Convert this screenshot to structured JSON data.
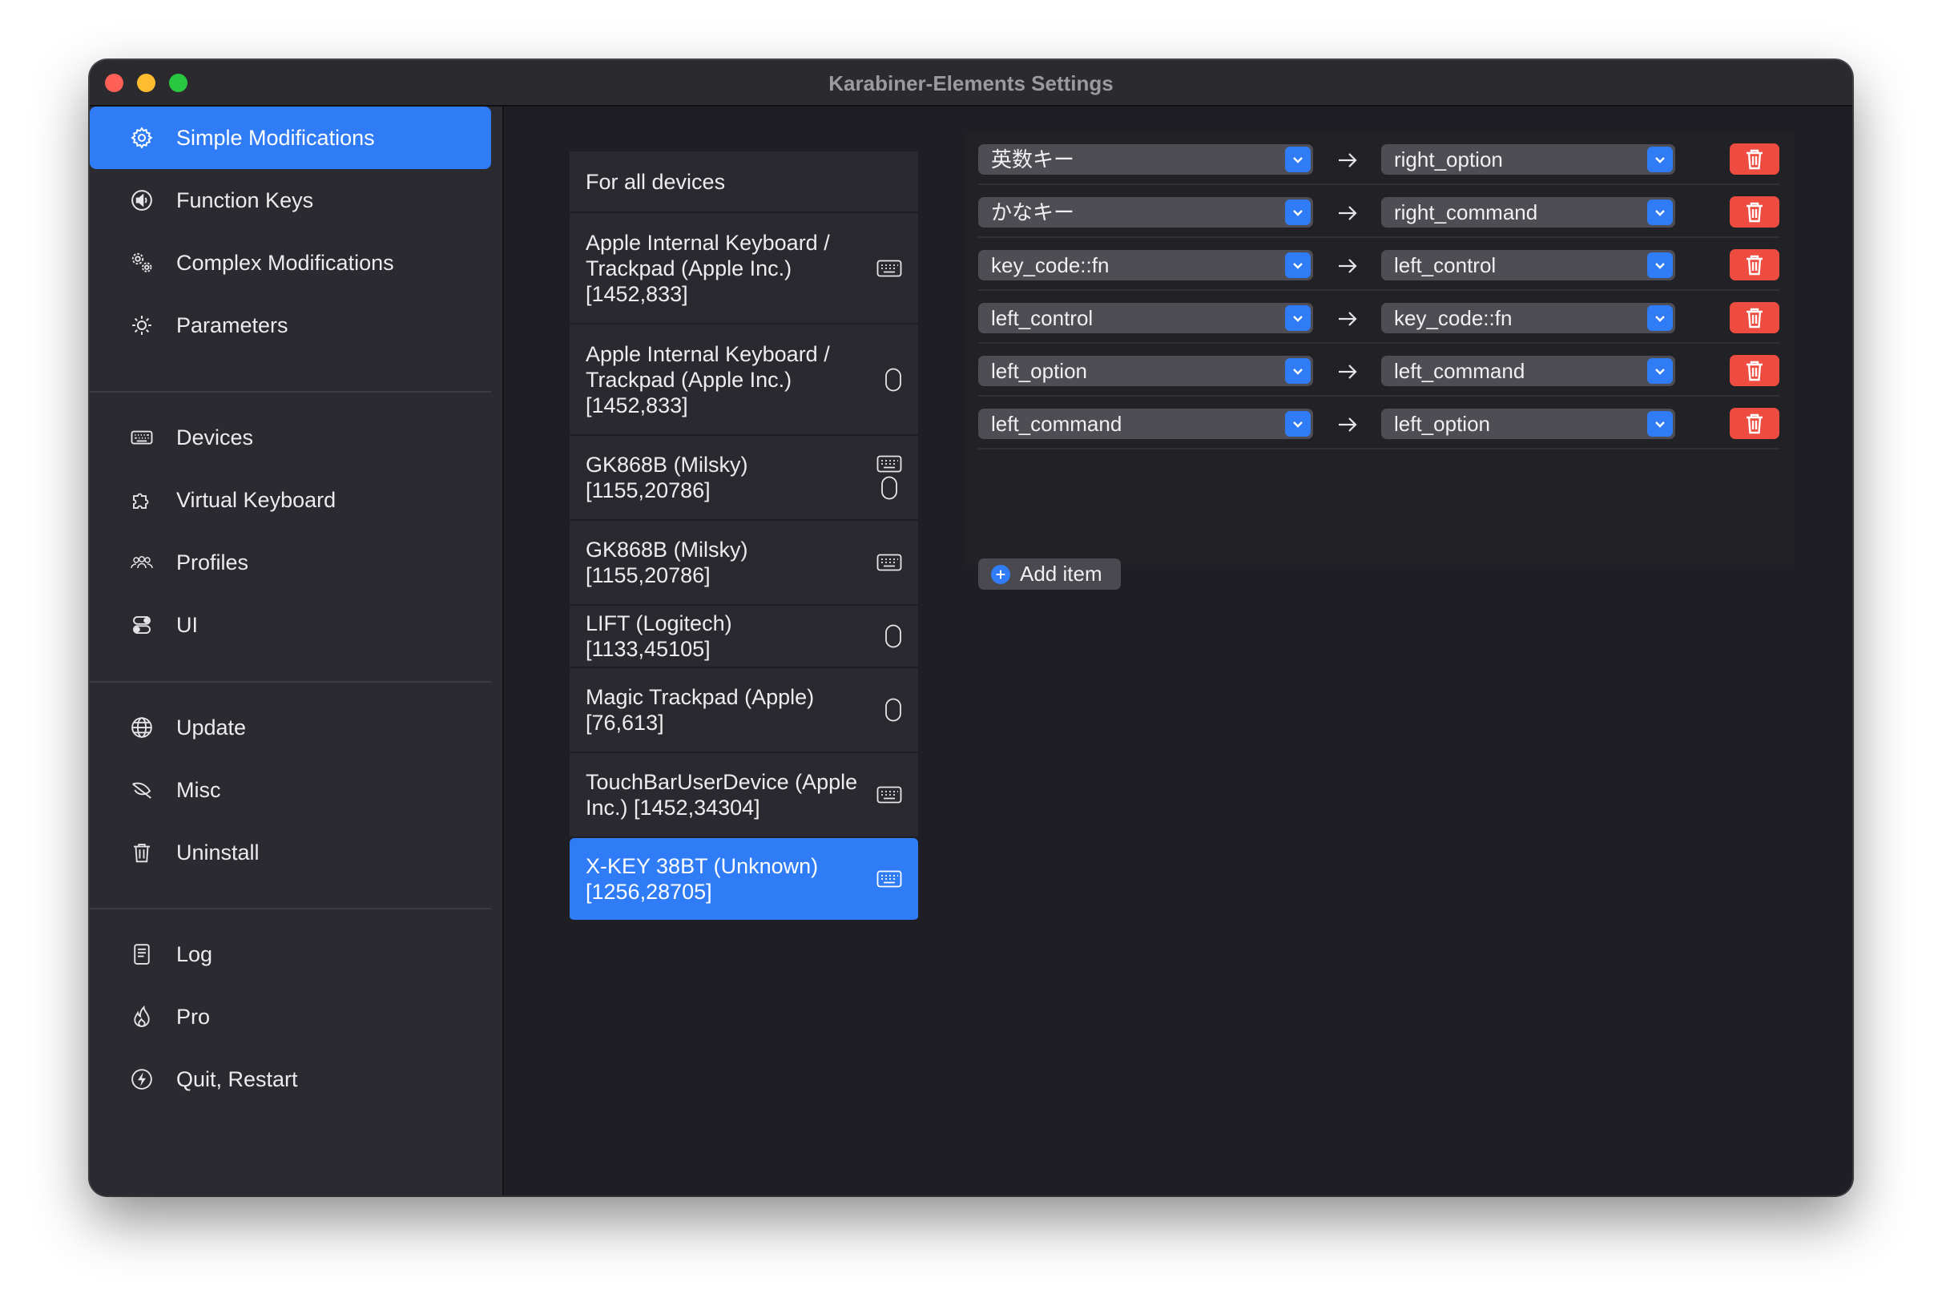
{
  "window": {
    "title": "Karabiner-Elements Settings"
  },
  "colors": {
    "accent": "#2f7cf6",
    "danger": "#ee4c41",
    "background": "#1f1e25",
    "sidebar": "#2b2a30"
  },
  "sidebar": {
    "items": [
      {
        "label": "Simple Modifications",
        "icon": "gear-icon",
        "active": true
      },
      {
        "label": "Function Keys",
        "icon": "speaker-icon"
      },
      {
        "label": "Complex Modifications",
        "icon": "gears-icon"
      },
      {
        "label": "Parameters",
        "icon": "sun-icon"
      },
      {
        "label": "Devices",
        "icon": "keyboard-icon"
      },
      {
        "label": "Virtual Keyboard",
        "icon": "puzzle-icon"
      },
      {
        "label": "Profiles",
        "icon": "people-icon"
      },
      {
        "label": "UI",
        "icon": "toggles-icon"
      },
      {
        "label": "Update",
        "icon": "globe-icon"
      },
      {
        "label": "Misc",
        "icon": "leaf-icon"
      },
      {
        "label": "Uninstall",
        "icon": "trash-icon"
      },
      {
        "label": "Log",
        "icon": "document-icon"
      },
      {
        "label": "Pro",
        "icon": "flame-icon"
      },
      {
        "label": "Quit, Restart",
        "icon": "bolt-icon"
      }
    ]
  },
  "devices": [
    {
      "label": "For all devices",
      "icons": []
    },
    {
      "label": "Apple Internal Keyboard /\nTrackpad (Apple Inc.)\n[1452,833]",
      "icons": [
        "keyboard-icon"
      ]
    },
    {
      "label": "Apple Internal Keyboard /\nTrackpad (Apple Inc.)\n[1452,833]",
      "icons": [
        "mouse-icon"
      ]
    },
    {
      "label": "GK868B (Milsky)\n[1155,20786]",
      "icons": [
        "keyboard-icon",
        "mouse-icon"
      ]
    },
    {
      "label": "GK868B (Milsky)\n[1155,20786]",
      "icons": [
        "keyboard-icon"
      ]
    },
    {
      "label": "LIFT (Logitech) [1133,45105]",
      "icons": [
        "mouse-icon"
      ]
    },
    {
      "label": "Magic Trackpad (Apple)\n[76,613]",
      "icons": [
        "mouse-icon"
      ]
    },
    {
      "label": "TouchBarUserDevice (Apple\nInc.) [1452,34304]",
      "icons": [
        "keyboard-icon"
      ]
    },
    {
      "label": "X-KEY 38BT (Unknown)\n[1256,28705]",
      "icons": [
        "keyboard-icon"
      ],
      "selected": true
    }
  ],
  "mappings": [
    {
      "from": "英数キー",
      "to": "right_option"
    },
    {
      "from": "かなキー",
      "to": "right_command"
    },
    {
      "from": "key_code::fn",
      "to": "left_control"
    },
    {
      "from": "left_control",
      "to": "key_code::fn"
    },
    {
      "from": "left_option",
      "to": "left_command"
    },
    {
      "from": "left_command",
      "to": "left_option"
    }
  ],
  "actions": {
    "add_item": "Add item"
  }
}
